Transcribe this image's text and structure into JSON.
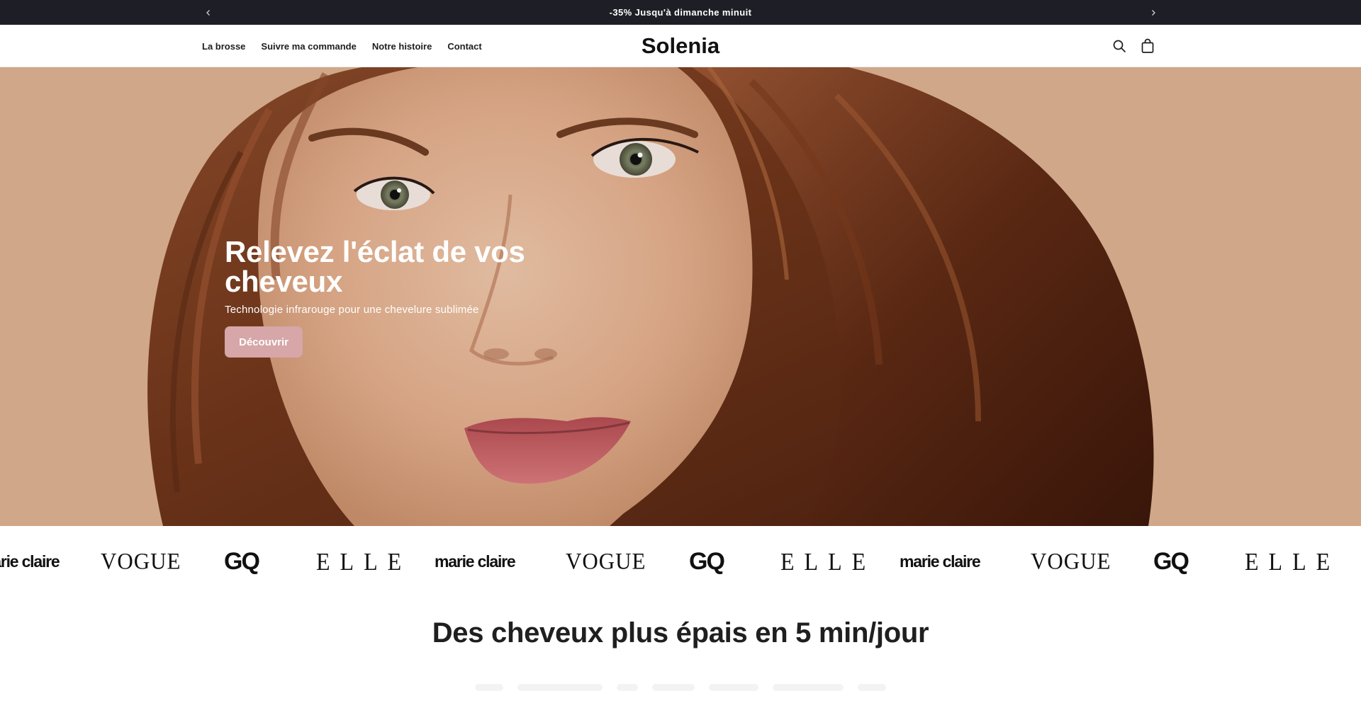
{
  "announcement": {
    "text": "-35% Jusqu'à dimanche minuit",
    "prev_icon": "chevron-left-icon",
    "next_icon": "chevron-right-icon"
  },
  "header": {
    "nav": [
      {
        "label": "La brosse"
      },
      {
        "label": "Suivre ma commande"
      },
      {
        "label": "Notre histoire"
      },
      {
        "label": "Contact"
      }
    ],
    "logo": "Solenia",
    "search_icon": "search-icon",
    "cart_icon": "shopping-bag-icon"
  },
  "hero": {
    "title": "Relevez l'éclat de vos cheveux",
    "subtitle": "Technologie infrarouge pour une chevelure sublimée",
    "cta": "Découvrir"
  },
  "press": {
    "logos": [
      {
        "name": "marie claire",
        "style": "marie"
      },
      {
        "name": "VOGUE",
        "style": "vogue"
      },
      {
        "name": "GQ",
        "style": "gq"
      },
      {
        "name": "ELLE",
        "style": "elle"
      },
      {
        "name": "marie claire",
        "style": "marie"
      },
      {
        "name": "VOGUE",
        "style": "vogue"
      },
      {
        "name": "GQ",
        "style": "gq"
      },
      {
        "name": "ELLE",
        "style": "elle"
      },
      {
        "name": "marie claire",
        "style": "marie"
      },
      {
        "name": "VOGUE",
        "style": "vogue"
      },
      {
        "name": "GQ",
        "style": "gq"
      },
      {
        "name": "ELLE",
        "style": "elle"
      }
    ]
  },
  "section": {
    "title": "Des cheveux plus épais en 5 min/jour"
  },
  "colors": {
    "announcement_bg": "#1e1f26",
    "button_bg": "#d6a6a8",
    "hero_bg": "#d8ad8d"
  }
}
